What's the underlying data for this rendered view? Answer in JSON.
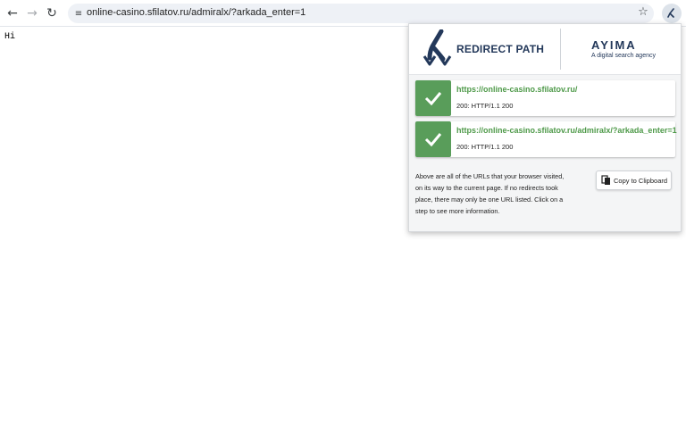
{
  "browser": {
    "back_icon": "arrow-left-icon",
    "forward_icon": "arrow-right-icon",
    "reload_icon": "reload-icon",
    "site_info_icon": "tune-icon",
    "url": "online-casino.sfilatov.ru/admiralx/?arkada_enter=1",
    "bookmark_icon": "star-icon",
    "extension_icon": "redirect-path-icon"
  },
  "page": {
    "text": "Hi"
  },
  "popup": {
    "brand": "REDIRECT PATH",
    "partner_name": "AYIMA",
    "partner_tagline": "A digital search agency",
    "steps": [
      {
        "url": "https://online-casino.sfilatov.ru/",
        "status": "200: HTTP/1.1 200"
      },
      {
        "url": "https://online-casino.sfilatov.ru/admiralx/?arkada_enter=1",
        "status": "200: HTTP/1.1 200"
      }
    ],
    "info": "Above are all of the URLs that your browser visited, on its way to the current page. If no redirects took place, there may only be one URL listed. Click on a step to see more information.",
    "copy_label": "Copy to Clipboard",
    "colors": {
      "success": "#599d5a",
      "link": "#4f9a4a",
      "brand": "#23385a"
    }
  }
}
